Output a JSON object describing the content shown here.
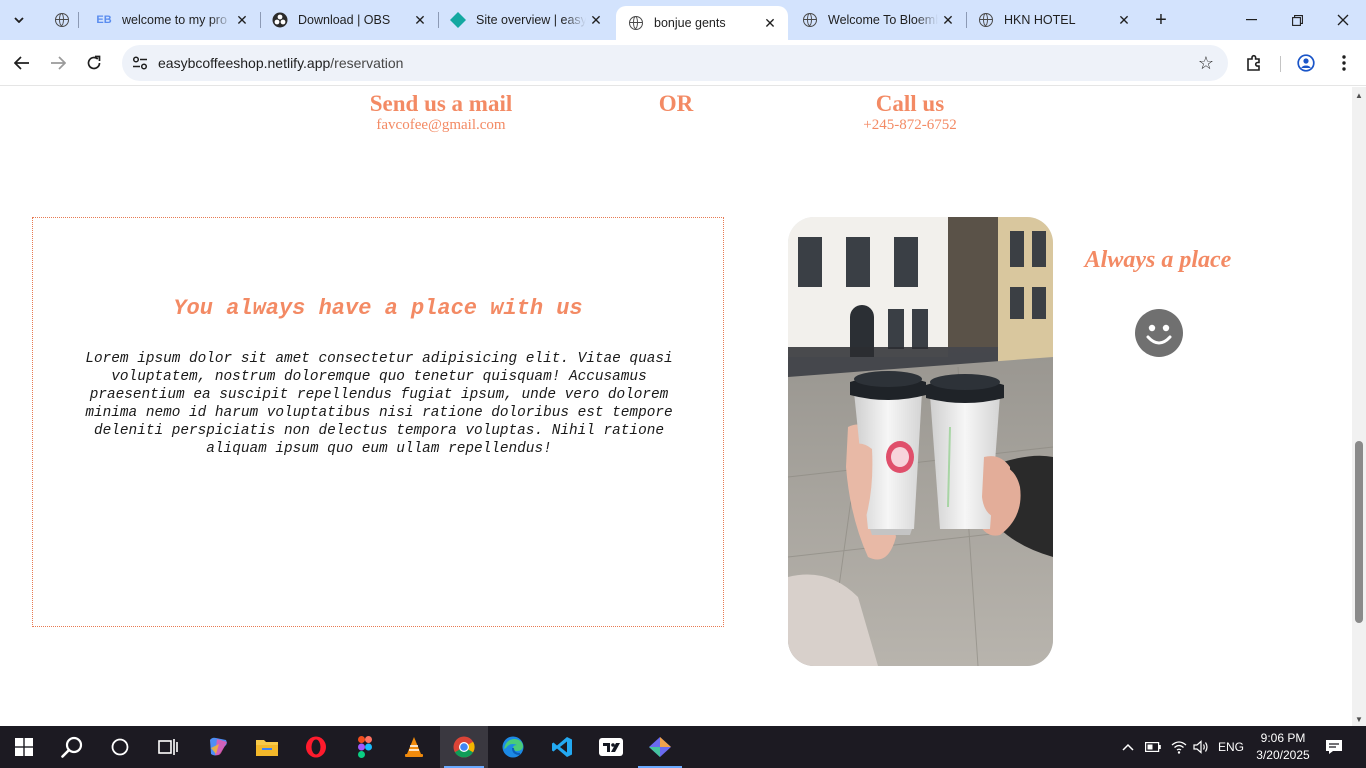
{
  "browser": {
    "tabs": [
      {
        "title": "",
        "favicon": "globe-icon"
      },
      {
        "title": "welcome to my pro",
        "favicon": "eb-icon"
      },
      {
        "title": "Download | OBS",
        "favicon": "obs-icon"
      },
      {
        "title": "Site overview | easyb",
        "favicon": "netlify-icon"
      },
      {
        "title": "bonjue gents",
        "favicon": "globe-icon",
        "active": true
      },
      {
        "title": "Welcome To Bloemb",
        "favicon": "globe-icon"
      },
      {
        "title": "HKN HOTEL",
        "favicon": "globe-icon"
      }
    ],
    "url_host": "easybcoffeeshop.netlify.app",
    "url_path": "/reservation"
  },
  "contact": {
    "mail_heading": "Send us a mail",
    "mail_value": "favcofee@gmail.com",
    "or_text": "OR",
    "call_heading": "Call us",
    "call_value": "+245-872-6752"
  },
  "card": {
    "heading": "You always have a place with us",
    "body": "Lorem ipsum dolor sit amet consectetur adipisicing elit. Vitae quasi voluptatem, nostrum doloremque quo tenetur quisquam! Accusamus praesentium ea suscipit repellendus fugiat ipsum, unde vero dolorem minima nemo id harum voluptatibus nisi ratione doloribus est tempore deleniti perspiciatis non delectus tempora voluptas. Nihil ratione aliquam ipsum quo eum ullam repellendus!"
  },
  "side": {
    "tagline": "Always a place",
    "smiley_icon": "smiley-icon"
  },
  "colors": {
    "accent": "#f38a64",
    "tabstrip": "#d3e3fd",
    "taskbar": "#1c1a22"
  },
  "taskbar": {
    "language": "ENG",
    "time": "9:06 PM",
    "date": "3/20/2025"
  }
}
